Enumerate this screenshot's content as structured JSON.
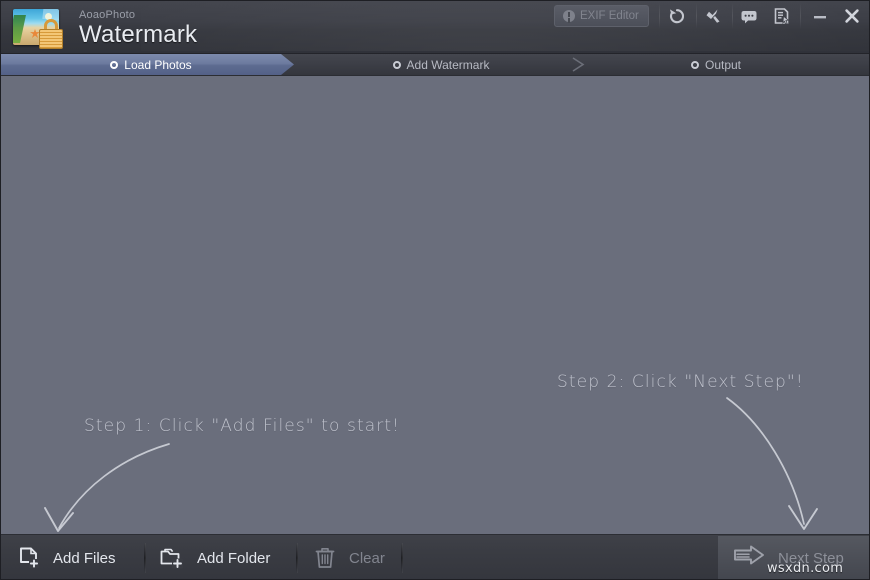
{
  "window": {
    "brand_sub": "AoaoPhoto",
    "brand_main": "Watermark",
    "logo_icon": "photo-lock-icon"
  },
  "header": {
    "exif_button": {
      "label": "EXIF Editor",
      "icon": "exclamation-circle-icon",
      "enabled": false
    },
    "icons": [
      {
        "name": "restore-icon",
        "title": "Restore"
      },
      {
        "name": "wrench-icon",
        "title": "Tools"
      },
      {
        "name": "chat-bubble-icon",
        "title": "Feedback"
      },
      {
        "name": "document-cursor-icon",
        "title": "Register"
      }
    ],
    "window_controls": [
      {
        "name": "minimize-button",
        "glyph": "minimize"
      },
      {
        "name": "close-button",
        "glyph": "close"
      }
    ]
  },
  "tabs": [
    {
      "label": "Load Photos",
      "active": true
    },
    {
      "label": "Add Watermark",
      "active": false
    },
    {
      "label": "Output",
      "active": false
    }
  ],
  "content": {
    "notes": [
      {
        "text": "Step 1: Click \"Add Files\" to start!"
      },
      {
        "text": "Step 2: Click \"Next Step\"!"
      }
    ],
    "file_list_empty": true
  },
  "toolbar": {
    "add_files": {
      "label": "Add Files",
      "icon": "file-add-icon",
      "enabled": true
    },
    "add_folder": {
      "label": "Add Folder",
      "icon": "folder-add-icon",
      "enabled": true
    },
    "clear": {
      "label": "Clear",
      "icon": "trash-icon",
      "enabled": false
    },
    "next_step": {
      "label": "Next Step",
      "icon": "arrow-right-icon",
      "enabled": true
    }
  },
  "watermark_text": "wsxdn.com",
  "colors": {
    "header_bg": "#3a3c44",
    "content_bg": "#6a6e7c",
    "tab_active": "#6d7b9f",
    "toolbar_bg": "#3a3c43",
    "text_primary": "#e3e6ec",
    "text_disabled": "#82858f",
    "logo_lock": "#d79a3a"
  }
}
